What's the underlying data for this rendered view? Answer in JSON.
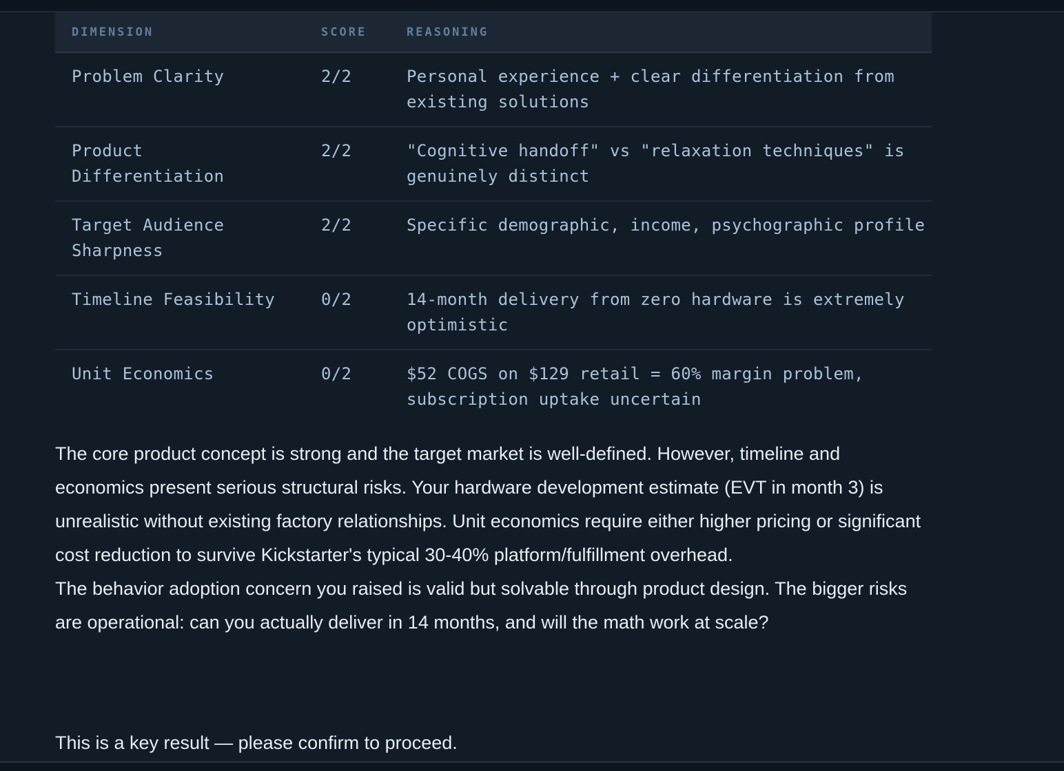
{
  "table": {
    "headers": {
      "dimension": "DIMENSION",
      "score": "SCORE",
      "reasoning": "REASONING"
    },
    "rows": [
      {
        "dimension": "Problem Clarity",
        "score": "2/2",
        "reasoning": "Personal experience + clear differentiation from existing solutions"
      },
      {
        "dimension": "Product Differentiation",
        "score": "2/2",
        "reasoning": "\"Cognitive handoff\" vs \"relaxation techniques\" is genuinely distinct"
      },
      {
        "dimension": "Target Audience Sharpness",
        "score": "2/2",
        "reasoning": "Specific demographic, income, psychographic profile"
      },
      {
        "dimension": "Timeline Feasibility",
        "score": "0/2",
        "reasoning": "14-month delivery from zero hardware is extremely optimistic"
      },
      {
        "dimension": "Unit Economics",
        "score": "0/2",
        "reasoning": "$52 COGS on $129 retail = 60% margin problem, subscription uptake uncertain"
      }
    ]
  },
  "summary": {
    "paragraph1": "The core product concept is strong and the target market is well-defined. However, timeline and economics present serious structural risks. Your hardware development estimate (EVT in month 3) is unrealistic without existing factory relationships. Unit economics require either higher pricing or significant cost reduction to survive Kickstarter's typical 30-40% platform/fulfillment overhead.",
    "paragraph2": "The behavior adoption concern you raised is valid but solvable through product design. The bigger risks are operational: can you actually deliver in 14 months, and will the math work at scale?"
  },
  "confirm_text": "This is a key result — please confirm to proceed."
}
